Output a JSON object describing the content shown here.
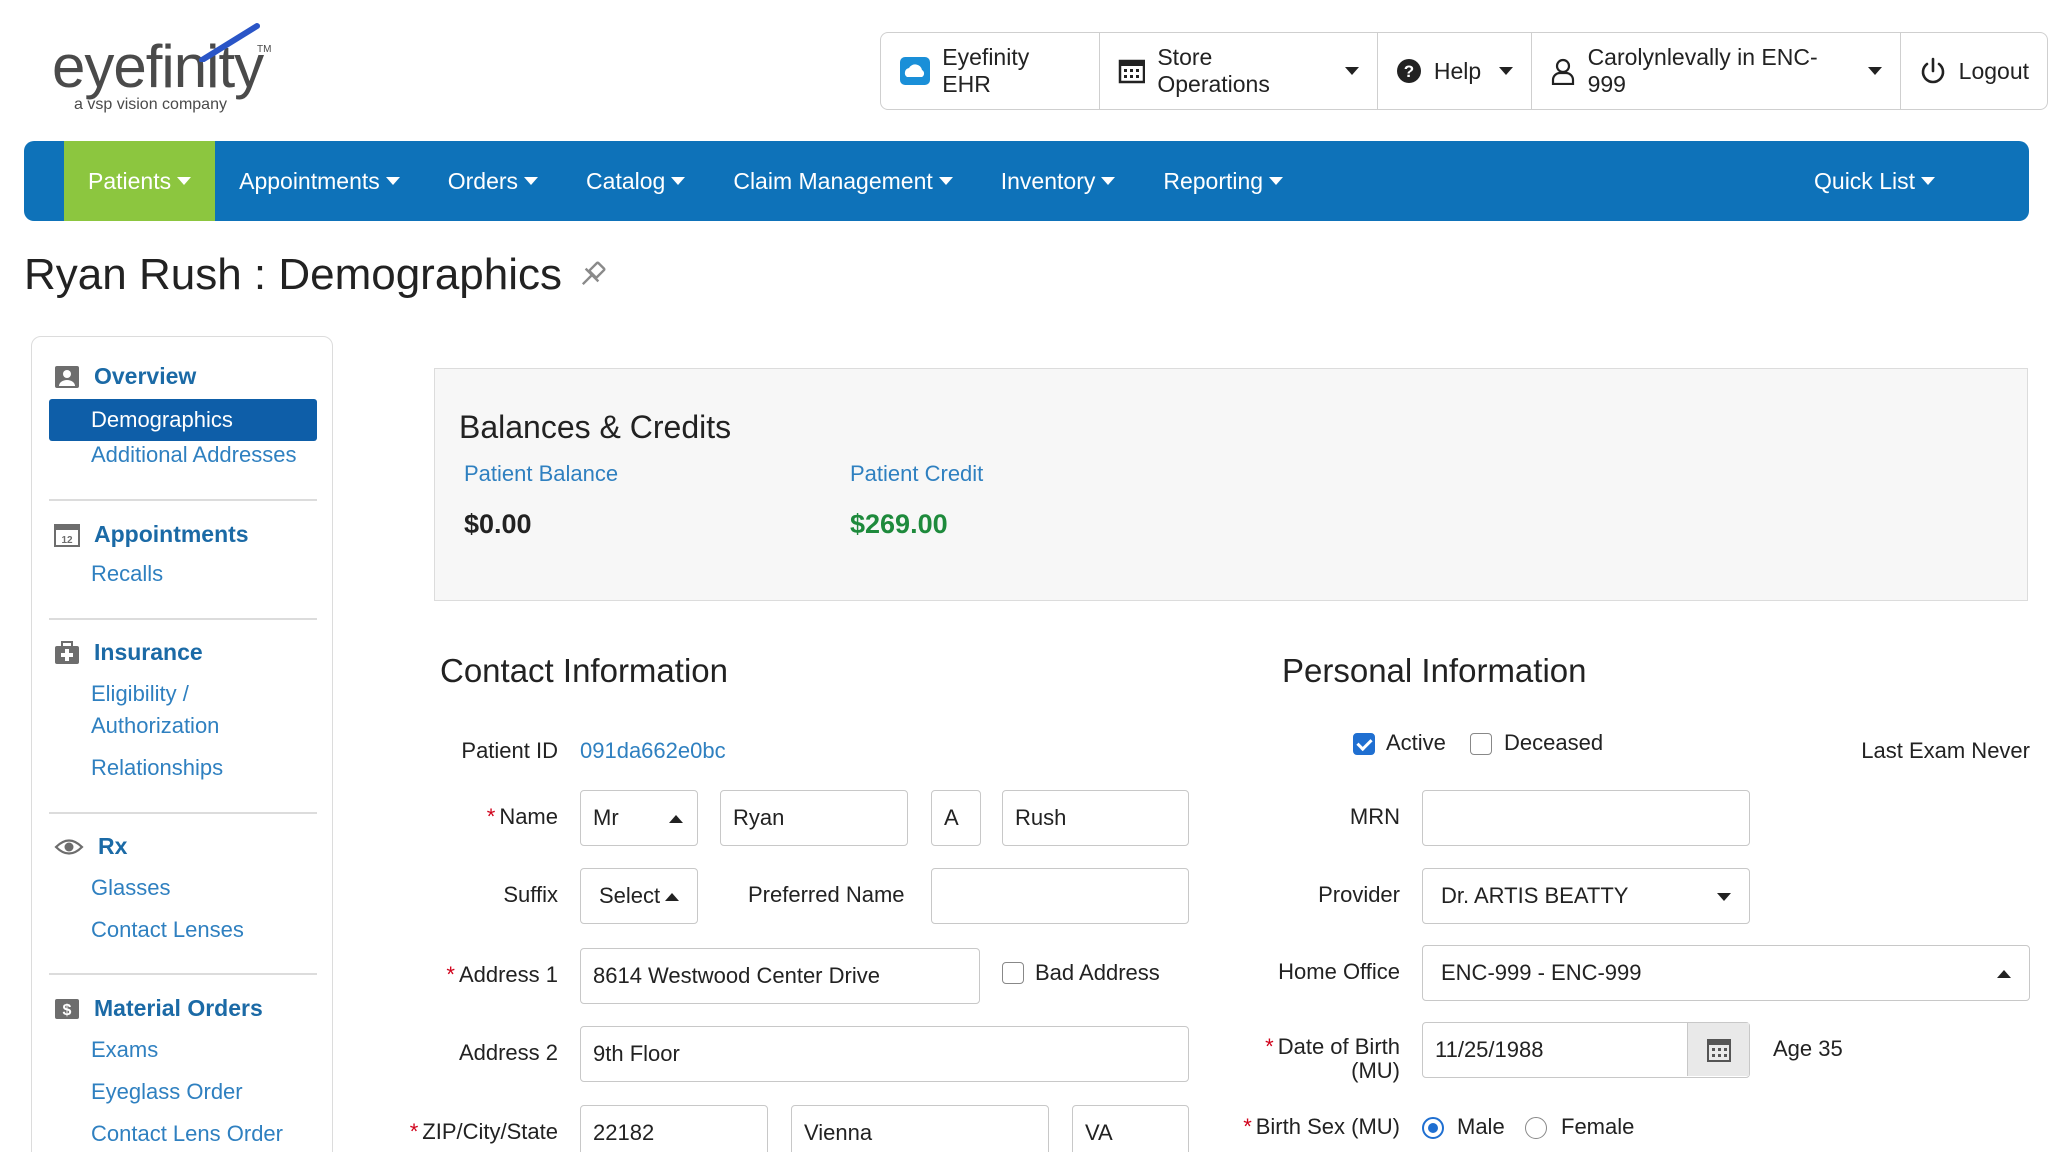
{
  "logo": {
    "word": "eyefinity",
    "tagline": "a vsp vision company",
    "tm": "TM"
  },
  "topbar": {
    "ehr": "Eyefinity EHR",
    "store_ops": "Store Operations",
    "help": "Help",
    "user": "Carolynlevally in ENC-999",
    "logout": "Logout"
  },
  "nav": {
    "items": [
      "Patients",
      "Appointments",
      "Orders",
      "Catalog",
      "Claim Management",
      "Inventory",
      "Reporting"
    ],
    "quick_list": "Quick List",
    "active_color": "#8cc63f",
    "bar_color": "#0e72b9"
  },
  "page_title": "Ryan Rush : Demographics",
  "sidebar": {
    "overview": "Overview",
    "demographics": "Demographics",
    "additional_addresses": "Additional Addresses",
    "appointments": "Appointments",
    "recalls": "Recalls",
    "insurance": "Insurance",
    "eligibility_1": "Eligibility /",
    "eligibility_2": "Authorization",
    "relationships": "Relationships",
    "rx": "Rx",
    "glasses": "Glasses",
    "contact_lenses": "Contact Lenses",
    "material_orders": "Material Orders",
    "exams": "Exams",
    "eyeglass_order": "Eyeglass Order",
    "contact_lens_order": "Contact Lens Order"
  },
  "balances": {
    "title": "Balances & Credits",
    "patient_balance_label": "Patient Balance",
    "patient_balance": "$0.00",
    "patient_credit_label": "Patient Credit",
    "patient_credit": "$269.00",
    "credit_color": "#1e8a3c"
  },
  "contact": {
    "title": "Contact Information",
    "patient_id_label": "Patient ID",
    "patient_id": "091da662e0bc",
    "name_label": "Name",
    "title_value": "Mr",
    "first": "Ryan",
    "middle": "A",
    "last": "Rush",
    "suffix_label": "Suffix",
    "suffix_value": "Select",
    "preferred_label": "Preferred Name",
    "preferred_value": "",
    "address1_label": "Address 1",
    "address1": "8614 Westwood Center Drive",
    "bad_address": "Bad Address",
    "address2_label": "Address 2",
    "address2": "9th Floor",
    "zip_label": "ZIP/City/State",
    "zip": "22182",
    "city": "Vienna",
    "state": "VA"
  },
  "personal": {
    "title": "Personal Information",
    "active": "Active",
    "deceased": "Deceased",
    "last_exam": "Last Exam Never",
    "mrn_label": "MRN",
    "mrn": "",
    "provider_label": "Provider",
    "provider": "Dr. ARTIS BEATTY",
    "home_office_label": "Home Office",
    "home_office": "ENC-999 - ENC-999",
    "dob_label_1": "Date of Birth",
    "dob_label_2": "(MU)",
    "dob": "11/25/1988",
    "age": "Age 35",
    "sex_label": "Birth Sex (MU)",
    "male": "Male",
    "female": "Female"
  }
}
